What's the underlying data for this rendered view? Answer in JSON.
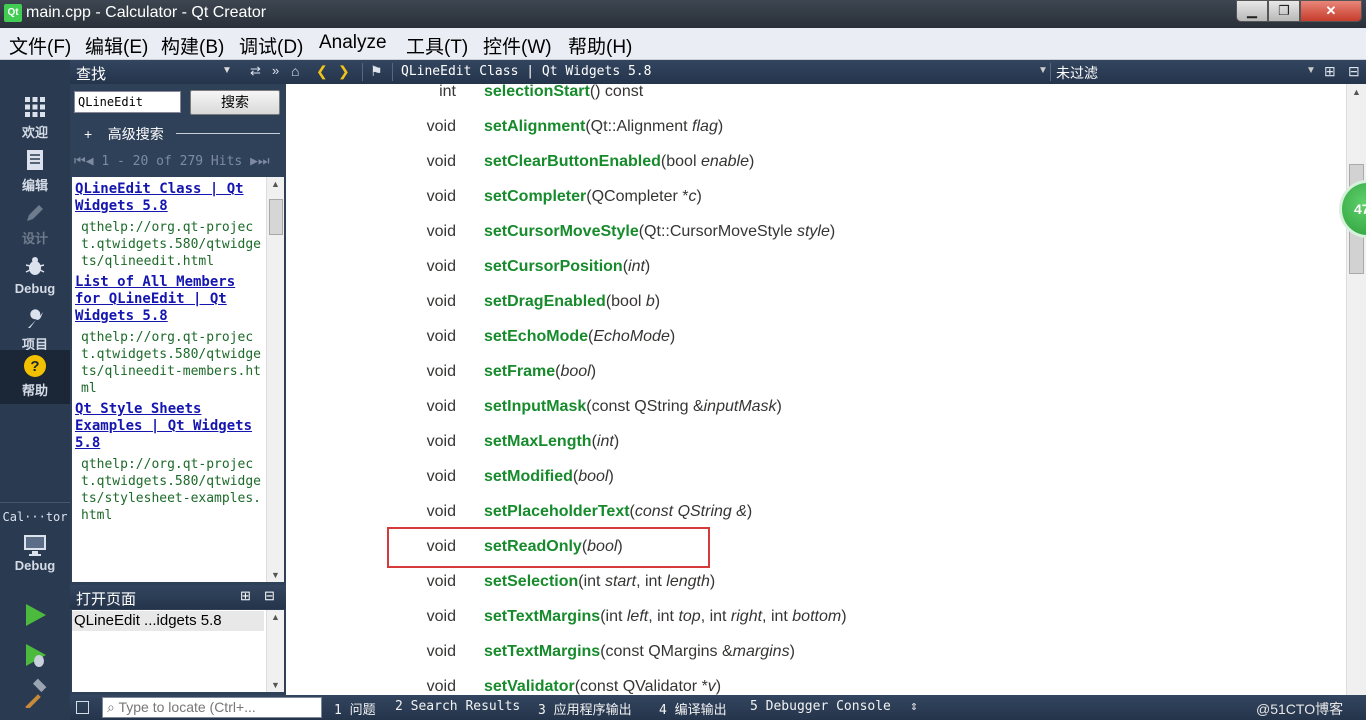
{
  "window": {
    "title": "main.cpp - Calculator - Qt Creator",
    "app_icon": "Qt",
    "minimize": "▁",
    "maximize": "❐",
    "close": "✕"
  },
  "menubar": {
    "items": [
      "文件(F)",
      "编辑(E)",
      "构建(B)",
      "调试(D)",
      "Analyze",
      "工具(T)",
      "控件(W)",
      "帮助(H)"
    ]
  },
  "modes": [
    {
      "label": "欢迎",
      "icon": "grid-icon"
    },
    {
      "label": "编辑",
      "icon": "document-icon"
    },
    {
      "label": "设计",
      "icon": "pencil-icon"
    },
    {
      "label": "Debug",
      "icon": "bug-icon"
    },
    {
      "label": "项目",
      "icon": "wrench-icon"
    },
    {
      "label": "帮助",
      "icon": "help-icon"
    }
  ],
  "kit": {
    "project": "Cal···tor",
    "config": "Debug"
  },
  "search_panel": {
    "title": "查找",
    "query": "QLineEdit",
    "search_button": "搜索",
    "advanced": "高级搜索",
    "hits": "1 - 20 of 279 Hits",
    "results": [
      {
        "title": "QLineEdit Class | Qt Widgets 5.8",
        "url": "qthelp://org.qt-project.qtwidgets.580/qtwidgets/qlineedit.html"
      },
      {
        "title": "List of All Members for QLineEdit | Qt Widgets 5.8",
        "url": "qthelp://org.qt-project.qtwidgets.580/qtwidgets/qlineedit-members.html"
      },
      {
        "title": "Qt Style Sheets Examples | Qt Widgets 5.8",
        "url": "qthelp://org.qt-project.qtwidgets.580/qtwidgets/stylesheet-examples.html"
      }
    ]
  },
  "open_pages": {
    "title": "打开页面",
    "items": [
      "QLineEdit ...idgets 5.8"
    ]
  },
  "doc_toolbar": {
    "page_title": "QLineEdit Class | Qt Widgets 5.8",
    "filter": "未过滤"
  },
  "functions": [
    {
      "type": "int",
      "name": "selectionStart",
      "rest": "() const"
    },
    {
      "type": "void",
      "name": "setAlignment",
      "rest": "(Qt::Alignment <i>flag</i>)"
    },
    {
      "type": "void",
      "name": "setClearButtonEnabled",
      "rest": "(bool <i>enable</i>)"
    },
    {
      "type": "void",
      "name": "setCompleter",
      "rest": "(QCompleter *<i>c</i>)"
    },
    {
      "type": "void",
      "name": "setCursorMoveStyle",
      "rest": "(Qt::CursorMoveStyle <i>style</i>)"
    },
    {
      "type": "void",
      "name": "setCursorPosition",
      "rest": "(<i>int</i>)"
    },
    {
      "type": "void",
      "name": "setDragEnabled",
      "rest": "(bool <i>b</i>)"
    },
    {
      "type": "void",
      "name": "setEchoMode",
      "rest": "(<i>EchoMode</i>)"
    },
    {
      "type": "void",
      "name": "setFrame",
      "rest": "(<i>bool</i>)"
    },
    {
      "type": "void",
      "name": "setInputMask",
      "rest": "(const QString &amp;<i>inputMask</i>)"
    },
    {
      "type": "void",
      "name": "setMaxLength",
      "rest": "(<i>int</i>)"
    },
    {
      "type": "void",
      "name": "setModified",
      "rest": "(<i>bool</i>)"
    },
    {
      "type": "void",
      "name": "setPlaceholderText",
      "rest": "(<i>const QString &amp;</i>)"
    },
    {
      "type": "void",
      "name": "setReadOnly",
      "rest": "(<i>bool</i>)"
    },
    {
      "type": "void",
      "name": "setSelection",
      "rest": "(int <i>start</i>, int <i>length</i>)"
    },
    {
      "type": "void",
      "name": "setTextMargins",
      "rest": "(int <i>left</i>, int <i>top</i>, int <i>right</i>, int <i>bottom</i>)"
    },
    {
      "type": "void",
      "name": "setTextMargins",
      "rest": "(const QMargins &amp;<i>margins</i>)"
    },
    {
      "type": "void",
      "name": "setValidator",
      "rest": "(const QValidator *<i>v</i>)"
    }
  ],
  "badge": "47",
  "statusbar": {
    "locator_placeholder": "Type to locate (Ctrl+...",
    "tabs": [
      "1 问题",
      "2 Search Results",
      "3 应用程序输出",
      "4 编译输出",
      "5 Debugger Console"
    ],
    "watermark": "@51CTO博客"
  },
  "colors": {
    "function_name": "#178b2c",
    "link": "#1515b0",
    "url": "#1d6a2a",
    "highlight": "#d63a3a",
    "sidebar": "#2a3a50"
  }
}
